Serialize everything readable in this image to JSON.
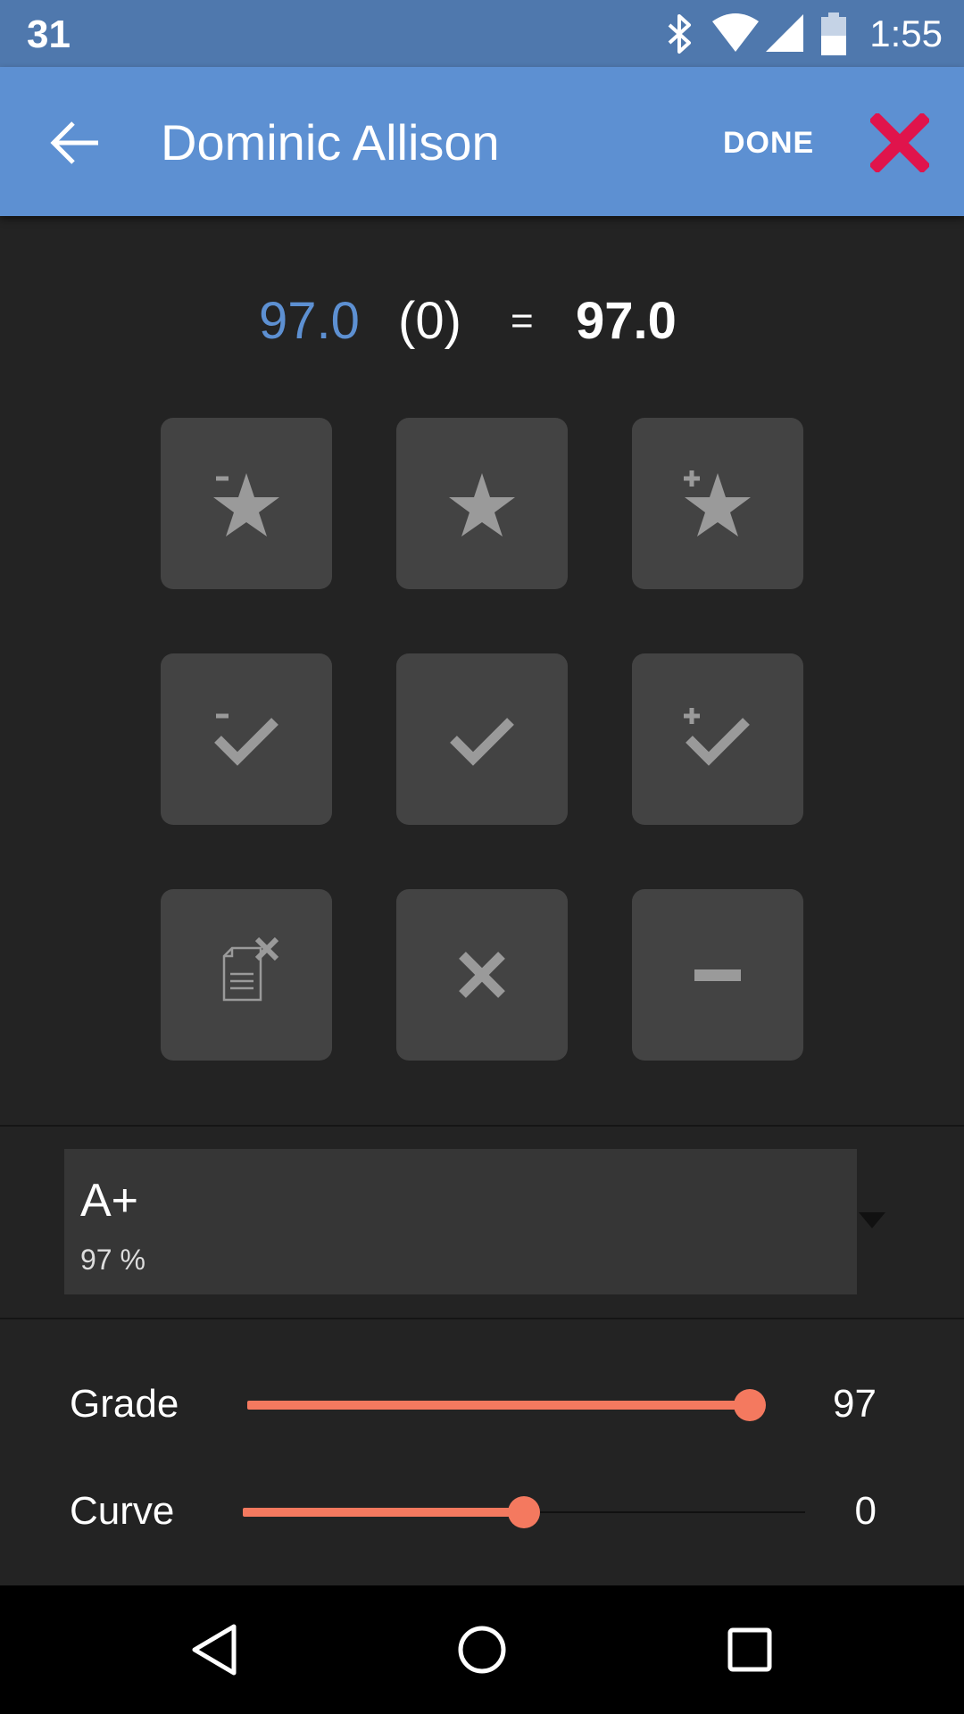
{
  "status_bar": {
    "date": "31",
    "time": "1:55",
    "icons": [
      "bluetooth-icon",
      "wifi-icon",
      "signal-icon",
      "battery-icon"
    ]
  },
  "app_bar": {
    "title": "Dominic Allison",
    "done_label": "DONE",
    "back_icon": "arrow-back-icon",
    "close_icon": "close-icon"
  },
  "score": {
    "raw": "97.0",
    "curve": "(0)",
    "equals": "=",
    "total": "97.0"
  },
  "grade_buttons": [
    {
      "name": "star-minus",
      "icon": "star-minus-icon"
    },
    {
      "name": "star",
      "icon": "star-icon"
    },
    {
      "name": "star-plus",
      "icon": "star-plus-icon"
    },
    {
      "name": "check-minus",
      "icon": "check-minus-icon"
    },
    {
      "name": "check",
      "icon": "check-icon"
    },
    {
      "name": "check-plus",
      "icon": "check-plus-icon"
    },
    {
      "name": "excused",
      "icon": "document-x-icon"
    },
    {
      "name": "incorrect",
      "icon": "x-icon"
    },
    {
      "name": "missing",
      "icon": "minus-icon"
    }
  ],
  "grade_select": {
    "letter": "A+",
    "percent": "97 %"
  },
  "sliders": {
    "grade": {
      "label": "Grade",
      "value": "97",
      "fraction": 0.97
    },
    "curve": {
      "label": "Curve",
      "value": "0",
      "fraction": 0.5
    }
  },
  "nav": {
    "icons": [
      "back-triangle-icon",
      "home-circle-icon",
      "recents-square-icon"
    ]
  },
  "colors": {
    "status_bar": "#4f78ad",
    "app_bar": "#5d90d2",
    "accent": "#f4795f",
    "close": "#e0144c",
    "background": "#232323",
    "button": "#434343"
  }
}
